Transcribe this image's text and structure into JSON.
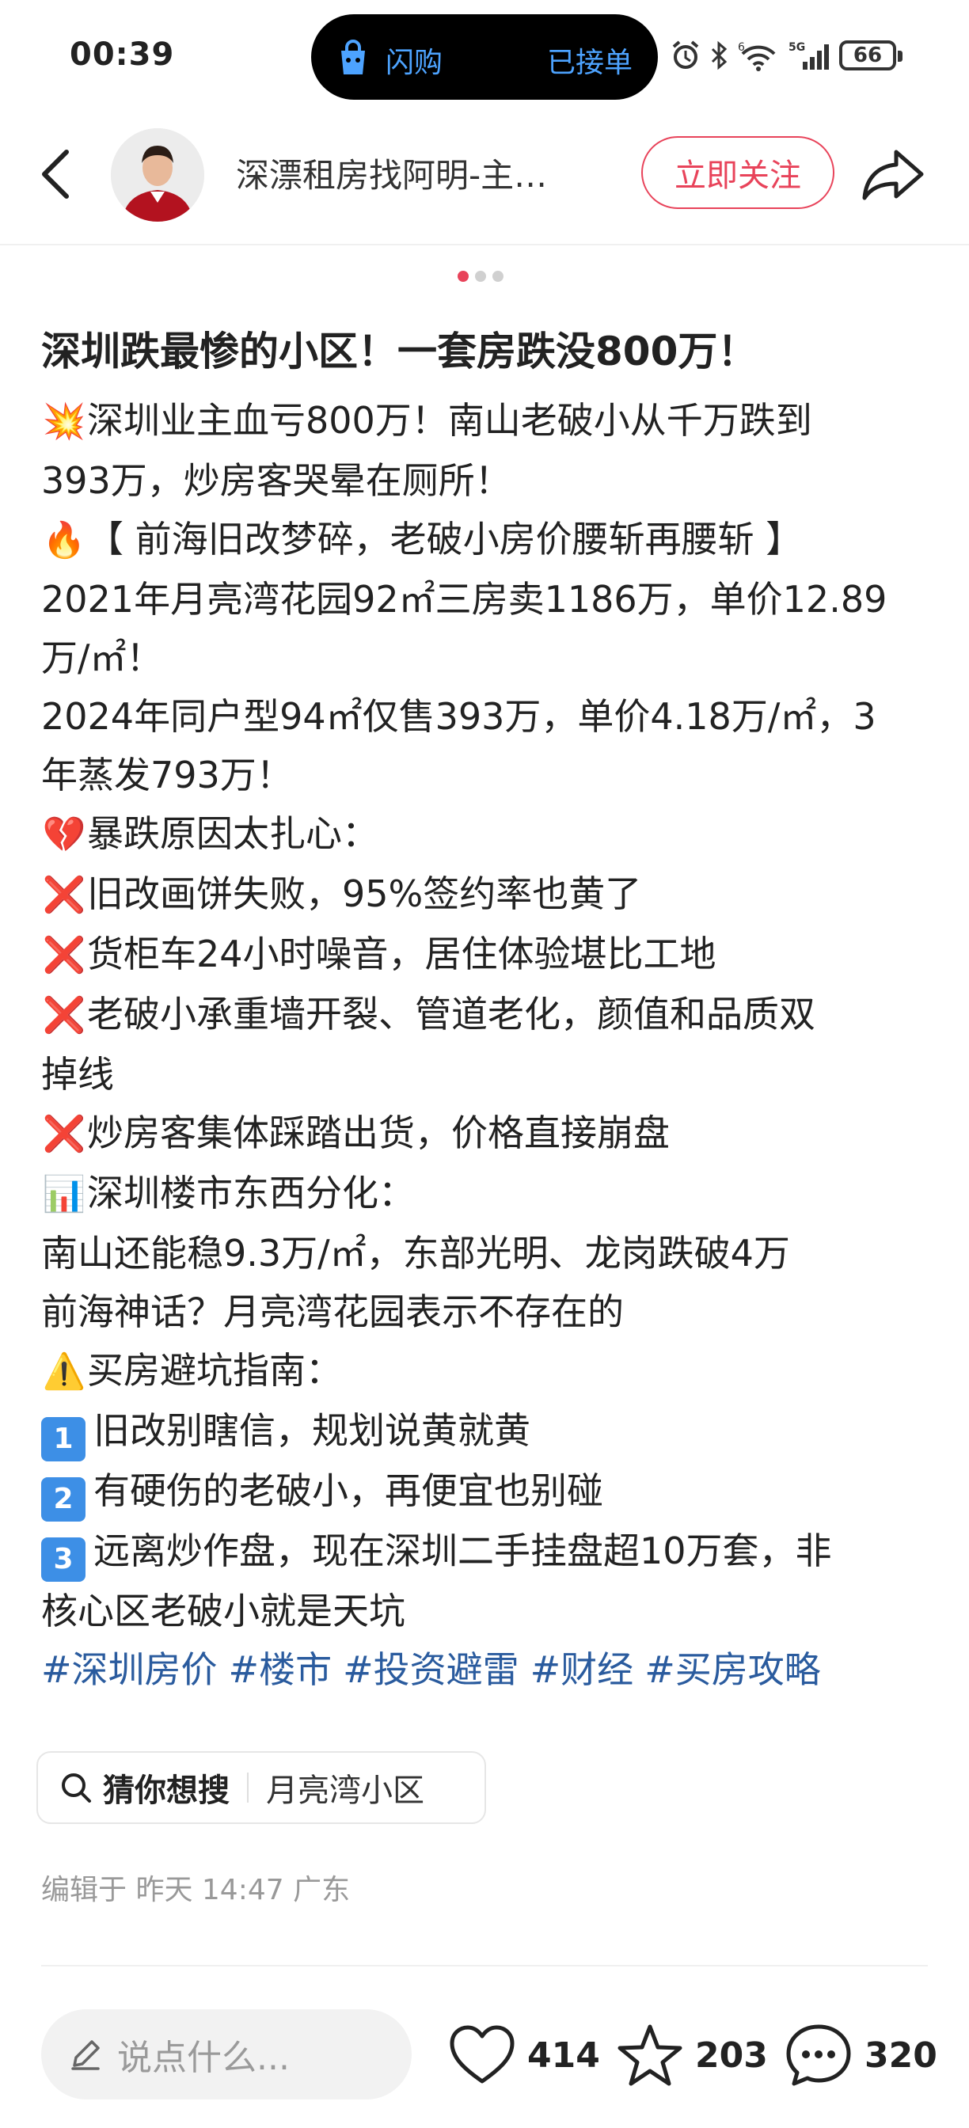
{
  "status_bar": {
    "time": "00:39",
    "island": {
      "app": "闪购",
      "status": "已接单",
      "accent": "#4da3ff"
    },
    "battery": "66",
    "network": "5G",
    "sim_tag": "6"
  },
  "header": {
    "author_name": "深漂租房找阿明-主…",
    "follow_label": "立即关注",
    "accent": "#e8435a",
    "icons": [
      "back-arrow-icon",
      "share-icon"
    ]
  },
  "carousel": {
    "total": 3,
    "active": 0
  },
  "article": {
    "title": "深圳跌最惨的小区！一套房跌没800万！",
    "lines": [
      {
        "icon": "💥",
        "icon_name": "collision-icon",
        "text": "深圳业主血亏800万！南山老破小从千万跌到"
      },
      {
        "icon": "",
        "text": "393万，炒房客哭晕在厕所！"
      },
      {
        "icon": "🔥",
        "icon_name": "fire-icon",
        "text": "【 前海旧改梦碎，老破小房价腰斩再腰斩 】"
      },
      {
        "icon": "",
        "text": "2021年月亮湾花园92㎡三房卖1186万，单价12.89"
      },
      {
        "icon": "",
        "text": "万/㎡！"
      },
      {
        "icon": "",
        "text": "2024年同户型94㎡仅售393万，单价4.18万/㎡，3"
      },
      {
        "icon": "",
        "text": "年蒸发793万！"
      },
      {
        "icon": "💔",
        "icon_name": "broken-heart-icon",
        "text": "暴跌原因太扎心："
      },
      {
        "icon": "❌",
        "icon_name": "cross-mark-icon",
        "text": "旧改画饼失败，95%签约率也黄了"
      },
      {
        "icon": "❌",
        "icon_name": "cross-mark-icon",
        "text": "货柜车24小时噪音，居住体验堪比工地"
      },
      {
        "icon": "❌",
        "icon_name": "cross-mark-icon",
        "text": "老破小承重墙开裂、管道老化，颜值和品质双"
      },
      {
        "icon": "",
        "text": "掉线"
      },
      {
        "icon": "❌",
        "icon_name": "cross-mark-icon",
        "text": "炒房客集体踩踏出货，价格直接崩盘"
      },
      {
        "icon": "📊",
        "icon_name": "bar-chart-icon",
        "text": "深圳楼市东西分化："
      },
      {
        "icon": "",
        "text": "南山还能稳9.3万/㎡，东部光明、龙岗跌破4万"
      },
      {
        "icon": "",
        "text": "前海神话？月亮湾花园表示不存在的"
      },
      {
        "icon": "⚠️",
        "icon_name": "warning-icon",
        "text": "买房避坑指南："
      },
      {
        "badge": "1",
        "text": "旧改别瞎信，规划说黄就黄"
      },
      {
        "badge": "2",
        "text": "有硬伤的老破小，再便宜也别碰"
      },
      {
        "badge": "3",
        "text": "远离炒作盘，现在深圳二手挂盘超10万套，非"
      },
      {
        "icon": "",
        "text": "核心区老破小就是天坑"
      }
    ],
    "tags": [
      "#深圳房价",
      "#楼市",
      "#投资避雷",
      "#财经",
      "#买房攻略"
    ],
    "tag_color": "#2a5b9e"
  },
  "search_hint": {
    "label": "猜你想搜",
    "query": "月亮湾小区"
  },
  "edit_info": "编辑于 昨天 14:47 广东",
  "bottom_bar": {
    "comment_placeholder": "说点什么...",
    "likes": "414",
    "favorites": "203",
    "comments": "320"
  }
}
